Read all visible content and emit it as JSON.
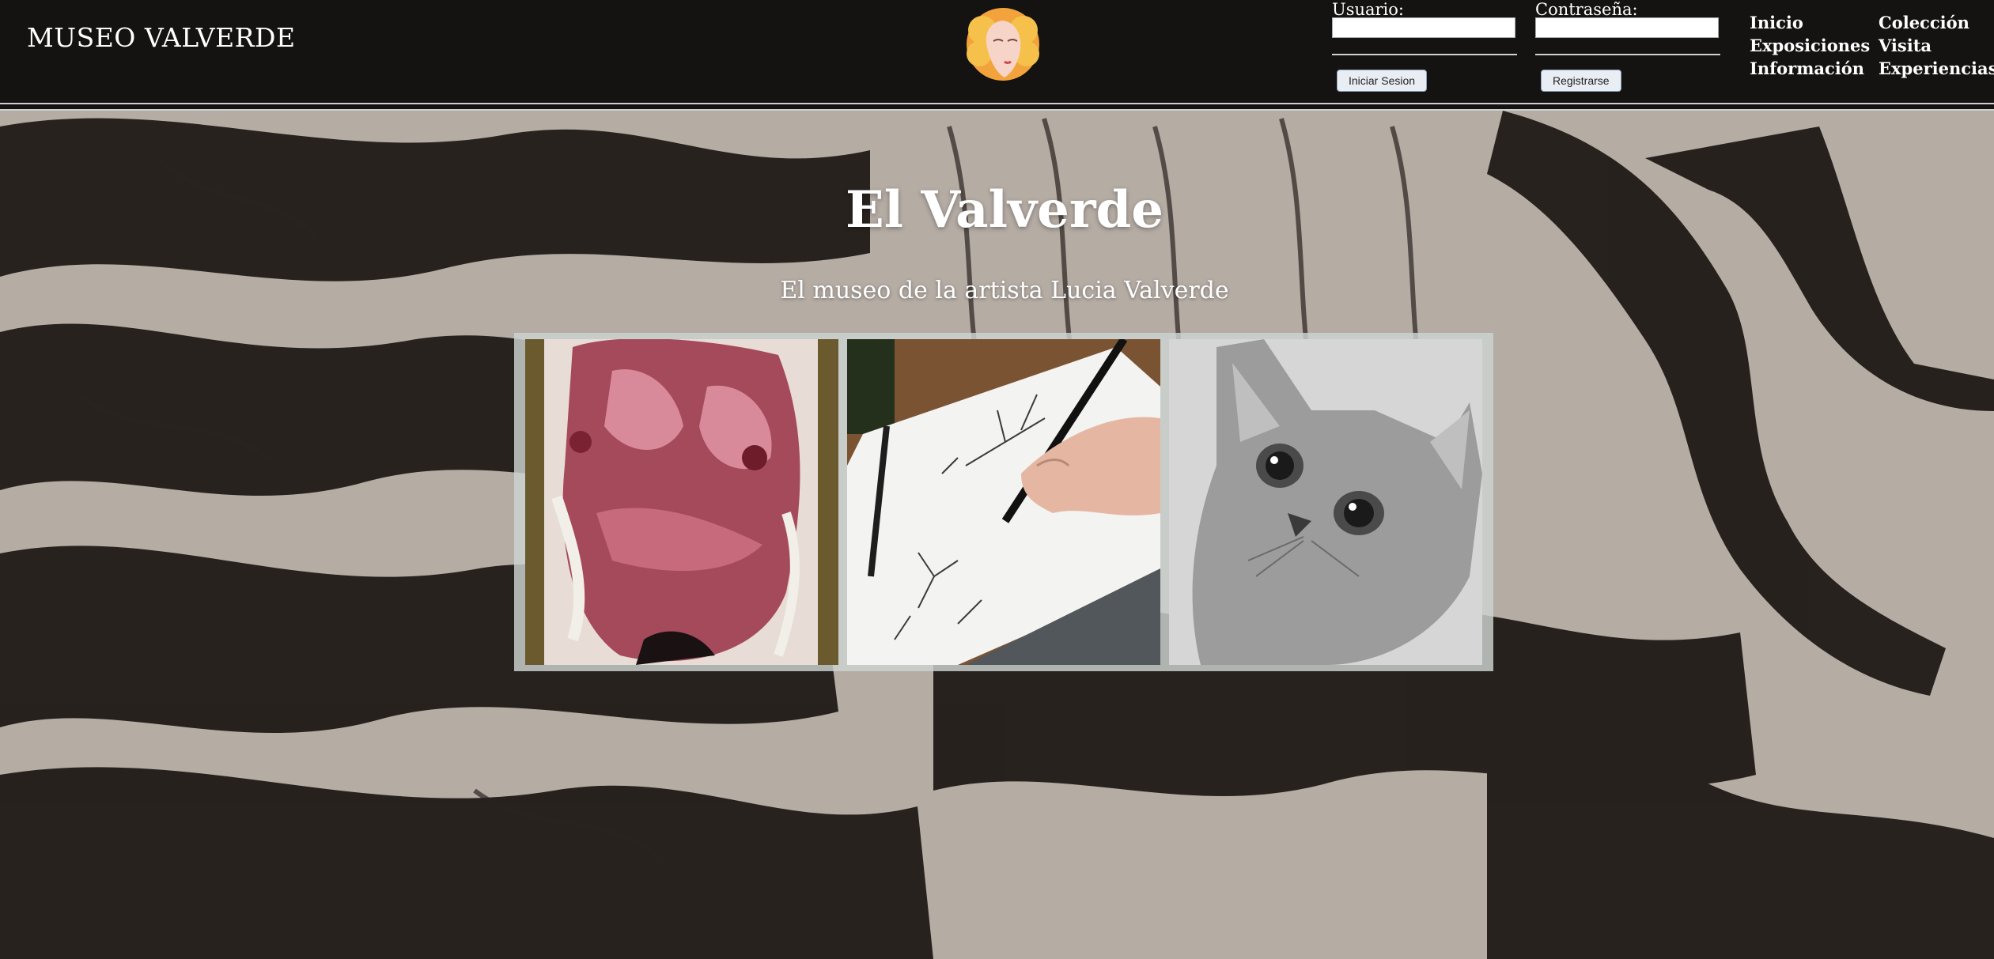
{
  "header": {
    "brand": "MUSEO VALVERDE",
    "logo_icon": "woman-face-logo-icon"
  },
  "login": {
    "user_label": "Usuario:",
    "user_value": "",
    "password_label": "Contraseña:",
    "password_value": "",
    "login_button": "Iniciar Sesion",
    "register_button": "Registrarse"
  },
  "nav": {
    "items": [
      {
        "label": "Inicio"
      },
      {
        "label": "Colección"
      },
      {
        "label": "Exposiciones"
      },
      {
        "label": "Visita"
      },
      {
        "label": "Información"
      },
      {
        "label": "Experiencias"
      }
    ]
  },
  "hero": {
    "title": "El Valverde",
    "subtitle": "El museo de la artista Lucia Valverde"
  },
  "gallery": {
    "images": [
      {
        "icon": "painting-torso-image"
      },
      {
        "icon": "pencil-drawing-trees-image"
      },
      {
        "icon": "cat-drawing-image"
      }
    ]
  },
  "colors": {
    "header_bg": "#151212",
    "page_bg": "#b7aea6",
    "ink": "#1a1412",
    "text": "#ffffff"
  }
}
